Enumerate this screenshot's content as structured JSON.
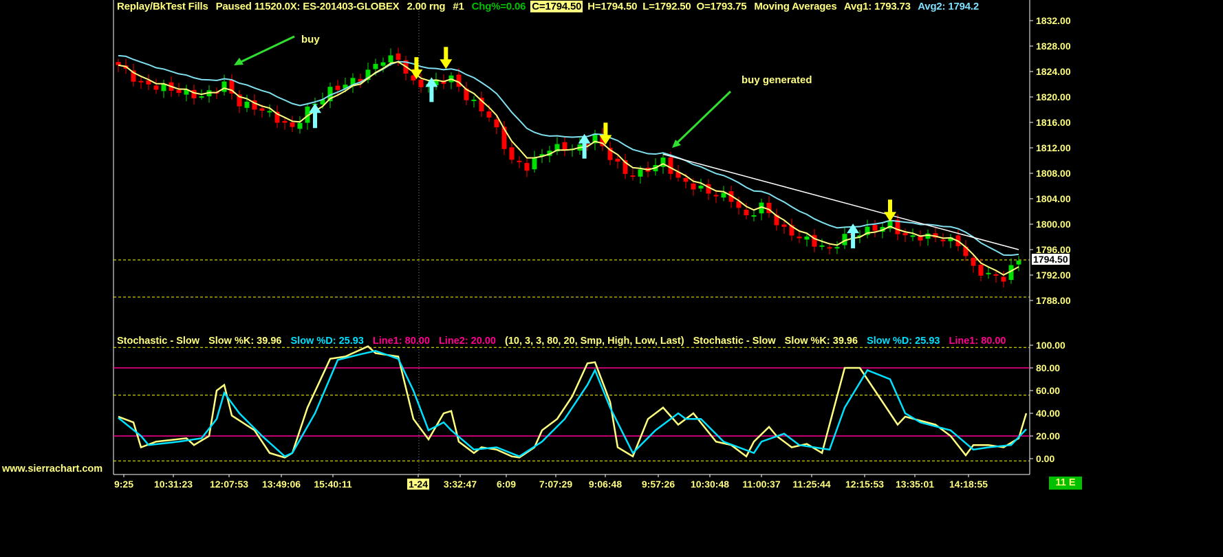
{
  "header": {
    "title": "Replay/BkTest Fills",
    "state": "Paused 11520.0X: ES-201403-GLOBEX",
    "range": "2.00 rng",
    "chart_num": "#1",
    "chg": "Chg%=0.06",
    "close": "C=1794.50",
    "high": "H=1794.50",
    "low": "L=1792.50",
    "open": "O=1793.75",
    "study": "Moving Averages",
    "avg1": "Avg1: 1793.73",
    "avg2": "Avg2: 1794.2"
  },
  "stoch_header": {
    "name": "Stochastic - Slow",
    "k": "Slow %K: 39.96",
    "d": "Slow %D: 25.93",
    "line1": "Line1: 80.00",
    "line2": "Line2: 20.00",
    "params": "(10, 3, 3, 80, 20, Smp, High, Low, Last)",
    "name2": "Stochastic - Slow",
    "k2": "Slow %K: 39.96",
    "d2": "Slow %D: 25.93",
    "line1_2": "Line1: 80.00"
  },
  "annotations": {
    "buy": "buy",
    "buy_generated": "buy generated"
  },
  "current_price": "1794.50",
  "brand": "www.sierrachart.com",
  "status_badge": "11 E",
  "colors": {
    "up": "#00e000",
    "down": "#ff0000",
    "avg1": "#ffff80",
    "avg2": "#80e0f0",
    "trend": "#ffffff",
    "k": "#ffff80",
    "d": "#00e0ff",
    "lines": "#ff0090",
    "sell_arrow": "#ffff00",
    "buy_arrow": "#80ffff"
  },
  "chart_data": [
    {
      "type": "candlestick",
      "title": "ES-201403-GLOBEX 2.00 rng",
      "ylim": [
        1786,
        1835
      ],
      "yticks": [
        "1832.00",
        "1828.00",
        "1824.00",
        "1820.00",
        "1816.00",
        "1812.00",
        "1808.00",
        "1804.00",
        "1800.00",
        "1796.00",
        "1792.00",
        "1788.00"
      ],
      "bars": 120,
      "close_path": [
        [
          0,
          1825
        ],
        [
          3,
          1822
        ],
        [
          6,
          1821.5
        ],
        [
          11,
          1820
        ],
        [
          14,
          1822
        ],
        [
          16,
          1819
        ],
        [
          19,
          1818
        ],
        [
          23,
          1815
        ],
        [
          25,
          1818
        ],
        [
          28,
          1821
        ],
        [
          32,
          1823
        ],
        [
          35,
          1826
        ],
        [
          37,
          1826
        ],
        [
          39,
          1822
        ],
        [
          41,
          1822
        ],
        [
          44,
          1823
        ],
        [
          46,
          1820
        ],
        [
          49,
          1817
        ],
        [
          52,
          1810
        ],
        [
          54,
          1809
        ],
        [
          57,
          1812
        ],
        [
          61,
          1812
        ],
        [
          63,
          1814
        ],
        [
          64,
          1812
        ],
        [
          67,
          1808
        ],
        [
          69,
          1808
        ],
        [
          72,
          1810
        ],
        [
          74,
          1807
        ],
        [
          78,
          1805
        ],
        [
          81,
          1804
        ],
        [
          83,
          1801
        ],
        [
          85,
          1803
        ],
        [
          88,
          1799
        ],
        [
          92,
          1797
        ],
        [
          94,
          1796
        ],
        [
          96,
          1798
        ],
        [
          99,
          1799
        ],
        [
          102,
          1800
        ],
        [
          104,
          1798
        ],
        [
          108,
          1798
        ],
        [
          111,
          1797
        ],
        [
          113,
          1793
        ],
        [
          115,
          1792
        ],
        [
          117,
          1791.5
        ],
        [
          119,
          1794.5
        ]
      ],
      "trend_line": [
        [
          72,
          1811
        ],
        [
          119,
          1796
        ]
      ],
      "signals": [
        {
          "type": "sell",
          "bar": 39.4,
          "price": 1822.8
        },
        {
          "type": "sell",
          "bar": 43.3,
          "price": 1824.4
        },
        {
          "type": "sell",
          "bar": 64.4,
          "price": 1812.5
        },
        {
          "type": "sell",
          "bar": 102,
          "price": 1800.4
        },
        {
          "type": "buy",
          "bar": 26,
          "price": 1819
        },
        {
          "type": "buy",
          "bar": 41.4,
          "price": 1823.1
        },
        {
          "type": "buy",
          "bar": 61.6,
          "price": 1814.2
        },
        {
          "type": "buy",
          "bar": 97.1,
          "price": 1800.1
        }
      ]
    },
    {
      "type": "line",
      "title": "Stochastic - Slow",
      "ylim": [
        -3,
        102
      ],
      "yticks": [
        "100.00",
        "80.00",
        "60.00",
        "40.00",
        "20.00",
        "0.00"
      ],
      "hlines": [
        80,
        20
      ],
      "dashed": [
        98,
        56,
        -2
      ],
      "series": [
        {
          "name": "Slow %K",
          "points": [
            [
              0,
              37
            ],
            [
              2,
              32
            ],
            [
              3,
              10
            ],
            [
              5,
              15
            ],
            [
              9,
              18
            ],
            [
              10,
              12
            ],
            [
              12,
              20
            ],
            [
              13,
              60
            ],
            [
              14,
              65
            ],
            [
              15,
              38
            ],
            [
              18,
              25
            ],
            [
              20,
              5
            ],
            [
              22,
              1
            ],
            [
              23,
              5
            ],
            [
              25,
              45
            ],
            [
              28,
              88
            ],
            [
              30,
              90
            ],
            [
              33,
              99
            ],
            [
              34,
              93
            ],
            [
              37,
              90
            ],
            [
              39,
              35
            ],
            [
              41,
              17
            ],
            [
              43,
              40
            ],
            [
              44,
              42
            ],
            [
              45,
              15
            ],
            [
              47,
              5
            ],
            [
              48,
              10
            ],
            [
              50,
              8
            ],
            [
              52,
              2
            ],
            [
              53,
              1
            ],
            [
              55,
              10
            ],
            [
              56,
              25
            ],
            [
              58,
              35
            ],
            [
              60,
              55
            ],
            [
              62,
              84
            ],
            [
              63,
              85
            ],
            [
              65,
              50
            ],
            [
              66,
              10
            ],
            [
              68,
              2
            ],
            [
              70,
              35
            ],
            [
              72,
              45
            ],
            [
              74,
              30
            ],
            [
              76,
              40
            ],
            [
              79,
              15
            ],
            [
              81,
              12
            ],
            [
              83,
              2
            ],
            [
              84,
              15
            ],
            [
              86,
              28
            ],
            [
              87,
              20
            ],
            [
              89,
              10
            ],
            [
              91,
              13
            ],
            [
              93,
              5
            ],
            [
              94,
              30
            ],
            [
              96,
              80
            ],
            [
              98,
              80
            ],
            [
              100,
              60
            ],
            [
              103,
              30
            ],
            [
              104,
              37
            ],
            [
              108,
              30
            ],
            [
              110,
              20
            ],
            [
              112,
              3
            ],
            [
              113,
              12
            ],
            [
              115,
              12
            ],
            [
              117,
              10
            ],
            [
              119,
              18
            ],
            [
              120,
              40
            ]
          ]
        },
        {
          "name": "Slow %D",
          "points": [
            [
              0,
              36
            ],
            [
              3,
              20
            ],
            [
              4,
              12
            ],
            [
              8,
              15
            ],
            [
              11,
              18
            ],
            [
              13,
              35
            ],
            [
              14,
              58
            ],
            [
              16,
              40
            ],
            [
              19,
              20
            ],
            [
              22,
              2
            ],
            [
              23,
              5
            ],
            [
              26,
              40
            ],
            [
              29,
              87
            ],
            [
              32,
              92
            ],
            [
              34,
              95
            ],
            [
              37,
              88
            ],
            [
              39,
              60
            ],
            [
              41,
              25
            ],
            [
              43,
              32
            ],
            [
              44,
              25
            ],
            [
              47,
              8
            ],
            [
              50,
              10
            ],
            [
              53,
              2
            ],
            [
              56,
              15
            ],
            [
              59,
              35
            ],
            [
              62,
              65
            ],
            [
              63,
              78
            ],
            [
              65,
              45
            ],
            [
              68,
              5
            ],
            [
              71,
              25
            ],
            [
              74,
              40
            ],
            [
              75,
              35
            ],
            [
              77,
              35
            ],
            [
              80,
              15
            ],
            [
              84,
              5
            ],
            [
              85,
              15
            ],
            [
              88,
              22
            ],
            [
              90,
              12
            ],
            [
              94,
              8
            ],
            [
              96,
              45
            ],
            [
              99,
              78
            ],
            [
              102,
              70
            ],
            [
              104,
              40
            ],
            [
              106,
              32
            ],
            [
              110,
              25
            ],
            [
              113,
              8
            ],
            [
              115,
              10
            ],
            [
              118,
              12
            ],
            [
              120,
              26
            ]
          ]
        }
      ]
    }
  ],
  "time_axis": [
    "9:25",
    "10:31:23",
    "12:07:53",
    "13:49:06",
    "15:40:11",
    "1-24",
    "3:32:47",
    "6:09",
    "7:07:29",
    "9:06:48",
    "9:57:26",
    "10:30:48",
    "11:00:37",
    "11:25:44",
    "12:15:53",
    "13:35:01",
    "14:18:55"
  ]
}
